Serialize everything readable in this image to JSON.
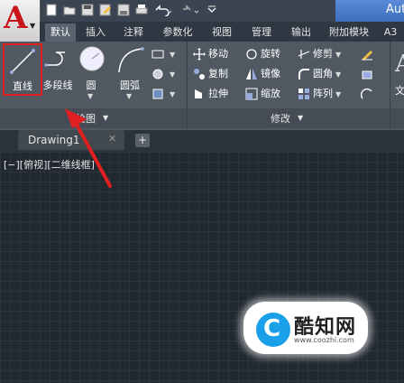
{
  "title_bar": {
    "title_partial": "Aut",
    "quick_access_icons": [
      "new-icon",
      "open-icon",
      "save-icon",
      "save-as-icon",
      "print-icon",
      "undo-icon",
      "redo-icon",
      "workspace-icon"
    ]
  },
  "app_button": {
    "glyph": "A",
    "dropdown": "▼"
  },
  "ribbon_tabs": [
    {
      "label": "默认",
      "active": true
    },
    {
      "label": "插入"
    },
    {
      "label": "注释"
    },
    {
      "label": "参数化"
    },
    {
      "label": "视图"
    },
    {
      "label": "管理"
    },
    {
      "label": "输出"
    },
    {
      "label": "附加模块"
    },
    {
      "label": "A3"
    }
  ],
  "draw_panel": {
    "title": "绘图",
    "buttons": {
      "line": "直线",
      "polyline": "多段线",
      "circle": "圆",
      "arc": "圆弧"
    }
  },
  "modify_panel": {
    "title": "修改",
    "buttons": {
      "move": "移动",
      "rotate": "旋转",
      "trim": "修剪",
      "copy": "复制",
      "mirror": "镜像",
      "fillet": "圆角",
      "stretch": "拉伸",
      "scale": "缩放",
      "array": "阵列"
    }
  },
  "partial_right_label": "文",
  "file_tabs": {
    "drawing": "Drawing1",
    "close": "✕",
    "new": "+"
  },
  "viewport_label": "[−][俯视][二维线框]",
  "watermark": {
    "name": "酷知网",
    "url": "www.coozhi.com",
    "logo_letter": "C"
  },
  "colors": {
    "highlight": "#e02020",
    "accent": "#1aa0e8",
    "canvas": "#212830"
  }
}
